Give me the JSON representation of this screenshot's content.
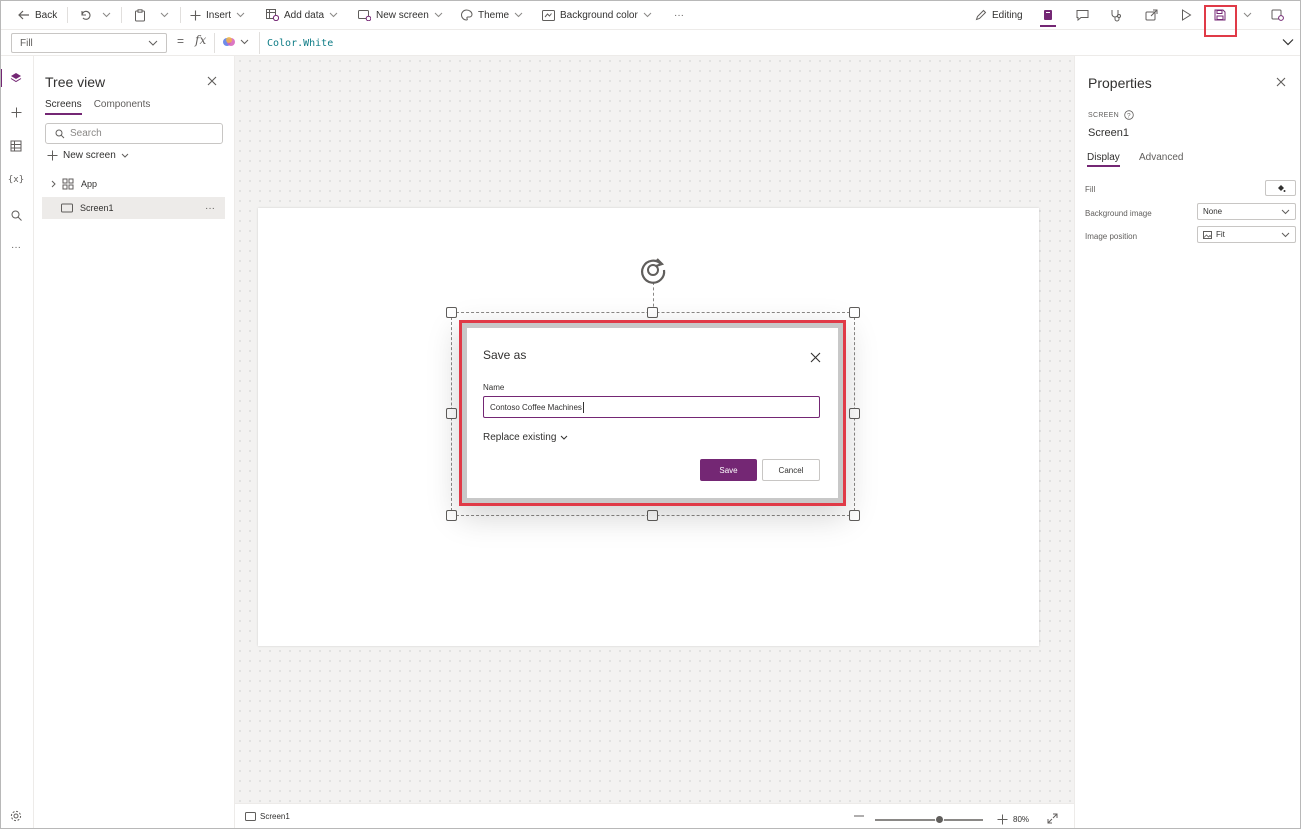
{
  "toolbar": {
    "back_label": "Back",
    "insert_label": "Insert",
    "add_data_label": "Add data",
    "new_screen_label": "New screen",
    "theme_label": "Theme",
    "background_color_label": "Background color",
    "more_label": "···",
    "editing_label": "Editing"
  },
  "formula_bar": {
    "property": "Fill",
    "equals": "=",
    "fx": "fx",
    "formula": "Color.White"
  },
  "tree_view": {
    "title": "Tree view",
    "tabs": [
      "Screens",
      "Components"
    ],
    "search_placeholder": "Search",
    "new_screen_label": "New screen",
    "nodes": [
      {
        "label": "App"
      },
      {
        "label": "Screen1",
        "more": "···"
      }
    ]
  },
  "dialog": {
    "title": "Save as",
    "name_label": "Name",
    "name_value": "Contoso Coffee Machines",
    "replace_label": "Replace existing",
    "save_label": "Save",
    "cancel_label": "Cancel"
  },
  "status": {
    "screen_name": "Screen1",
    "zoom": "80%",
    "zoom_fraction": 0.6
  },
  "properties": {
    "title": "Properties",
    "section": "SCREEN",
    "screen_name": "Screen1",
    "tabs": [
      "Display",
      "Advanced"
    ],
    "fill_label": "Fill",
    "background_image_label": "Background image",
    "background_image_value": "None",
    "image_position_label": "Image position",
    "image_position_value": "Fit"
  },
  "colors": {
    "accent": "#742774",
    "highlight": "#e03a47",
    "formula_text": "#0e7c86"
  }
}
